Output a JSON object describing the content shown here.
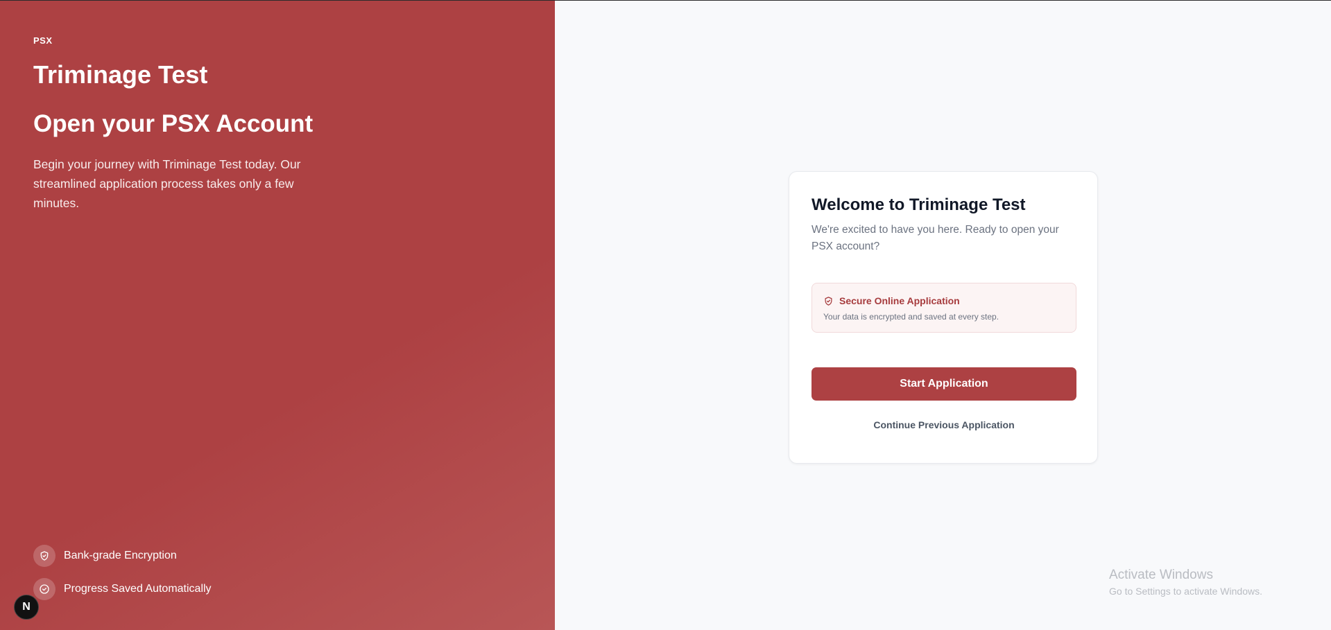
{
  "left_panel": {
    "brand": "PSX",
    "company_name": "Triminage Test",
    "headline": "Open your PSX Account",
    "intro": "Begin your journey with Triminage Test today. Our streamlined application process takes only a few minutes.",
    "features": [
      {
        "icon": "shield-check-icon",
        "label": "Bank-grade Encryption"
      },
      {
        "icon": "check-circle-icon",
        "label": "Progress Saved Automatically"
      }
    ],
    "dev_badge": "N",
    "accent_color": "#ad4143"
  },
  "card": {
    "title": "Welcome to Triminage Test",
    "subtitle": "We're excited to have you here. Ready to open your PSX account?",
    "secure": {
      "icon": "shield-check-icon",
      "title": "Secure Online Application",
      "text": "Your data is encrypted and saved at every step."
    },
    "start_button": "Start Application",
    "continue_link": "Continue Previous Application"
  },
  "watermark": {
    "title": "Activate Windows",
    "subtitle": "Go to Settings to activate Windows."
  }
}
